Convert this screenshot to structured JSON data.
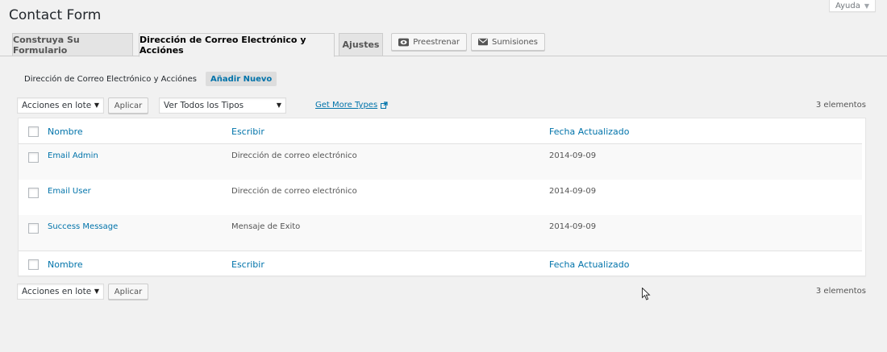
{
  "help": {
    "label": "Ayuda"
  },
  "page": {
    "title": "Contact Form"
  },
  "tabs": [
    {
      "label": "Construya Su Formulario",
      "active": false
    },
    {
      "label": "Dirección de Correo Electrónico y Acciónes",
      "active": true
    },
    {
      "label": "Ajustes",
      "active": false
    }
  ],
  "toolbar": {
    "preview_label": "Preestrenar",
    "submissions_label": "Sumisiones"
  },
  "section": {
    "heading": "Dirección de Correo Electrónico y Acciónes",
    "add_new_label": "Añadir Nuevo"
  },
  "filters": {
    "bulk_action_selected": "Acciones en lote",
    "apply_label": "Aplicar",
    "type_filter_selected": "Ver Todos los Tipos",
    "get_more_label": "Get More Types",
    "count_label": "3 elementos"
  },
  "table": {
    "columns": [
      "Nombre",
      "Escribir",
      "Fecha Actualizado"
    ],
    "rows": [
      {
        "name": "Email Admin",
        "type": "Dirección de correo electrónico",
        "date": "2014-09-09"
      },
      {
        "name": "Email User",
        "type": "Dirección de correo electrónico",
        "date": "2014-09-09"
      },
      {
        "name": "Success Message",
        "type": "Mensaje de Exito",
        "date": "2014-09-09"
      }
    ]
  },
  "bottom": {
    "bulk_action_selected": "Acciones en lote",
    "apply_label": "Aplicar",
    "count_label": "3 elementos"
  },
  "colors": {
    "link": "#0073aa",
    "background": "#f1f1f1",
    "table_bg": "#ffffff"
  }
}
